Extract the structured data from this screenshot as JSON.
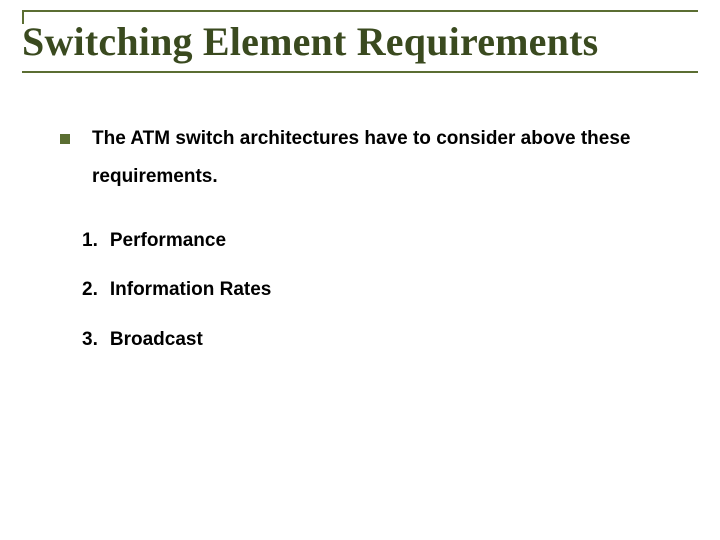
{
  "title": "Switching Element Requirements",
  "bullet": {
    "text": "The ATM switch architectures have to  consider above these requirements."
  },
  "items": [
    {
      "n": "1.",
      "label": "Performance"
    },
    {
      "n": "2.",
      "label": "Information Rates"
    },
    {
      "n": "3.",
      "label": "Broadcast"
    }
  ]
}
